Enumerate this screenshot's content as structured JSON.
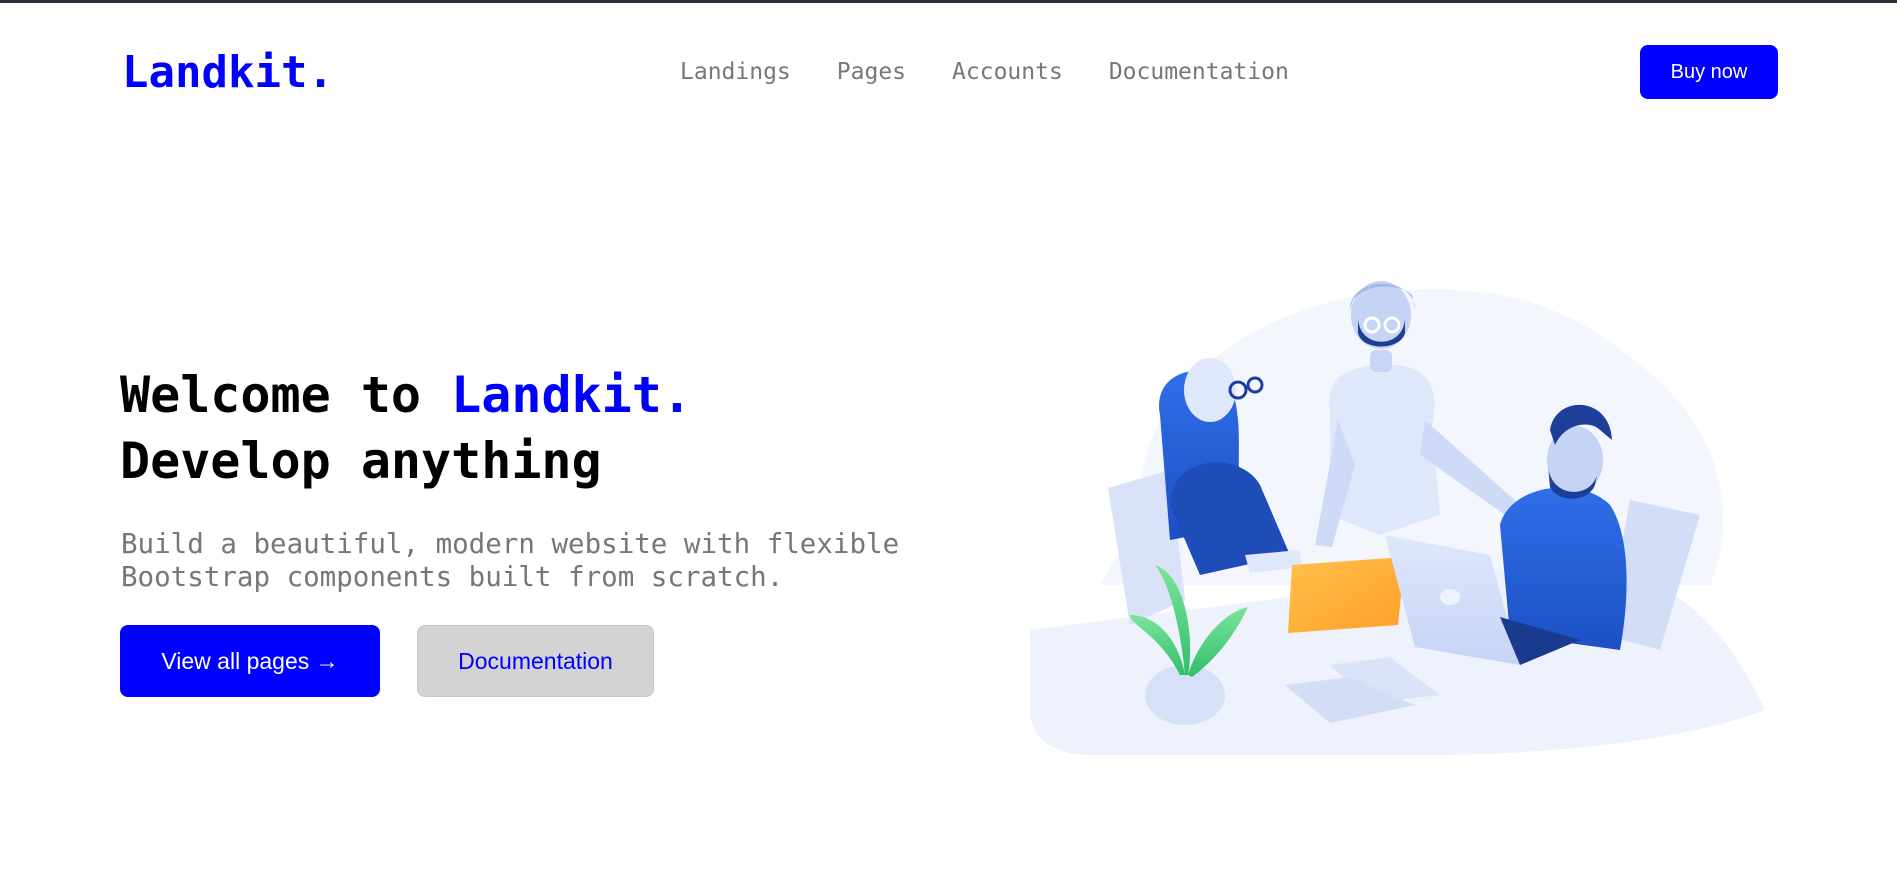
{
  "navbar": {
    "brand": "Landkit.",
    "links": [
      {
        "label": "Landings"
      },
      {
        "label": "Pages"
      },
      {
        "label": "Accounts"
      },
      {
        "label": "Documentation"
      }
    ],
    "buy_label": "Buy now"
  },
  "hero": {
    "title_prefix": "Welcome to ",
    "title_accent": "Landkit.",
    "title_line2": "Develop anything",
    "subtitle_line1": "Build a beautiful, modern website with flexible",
    "subtitle_line2": "Bootstrap components built from scratch.",
    "primary_label": "View all pages →",
    "secondary_label": "Documentation"
  },
  "colors": {
    "brand": "#0000ff",
    "muted_text": "#777777",
    "secondary_button": "#d3d3d3"
  },
  "illustration": {
    "icon": "team-meeting-illustration"
  }
}
